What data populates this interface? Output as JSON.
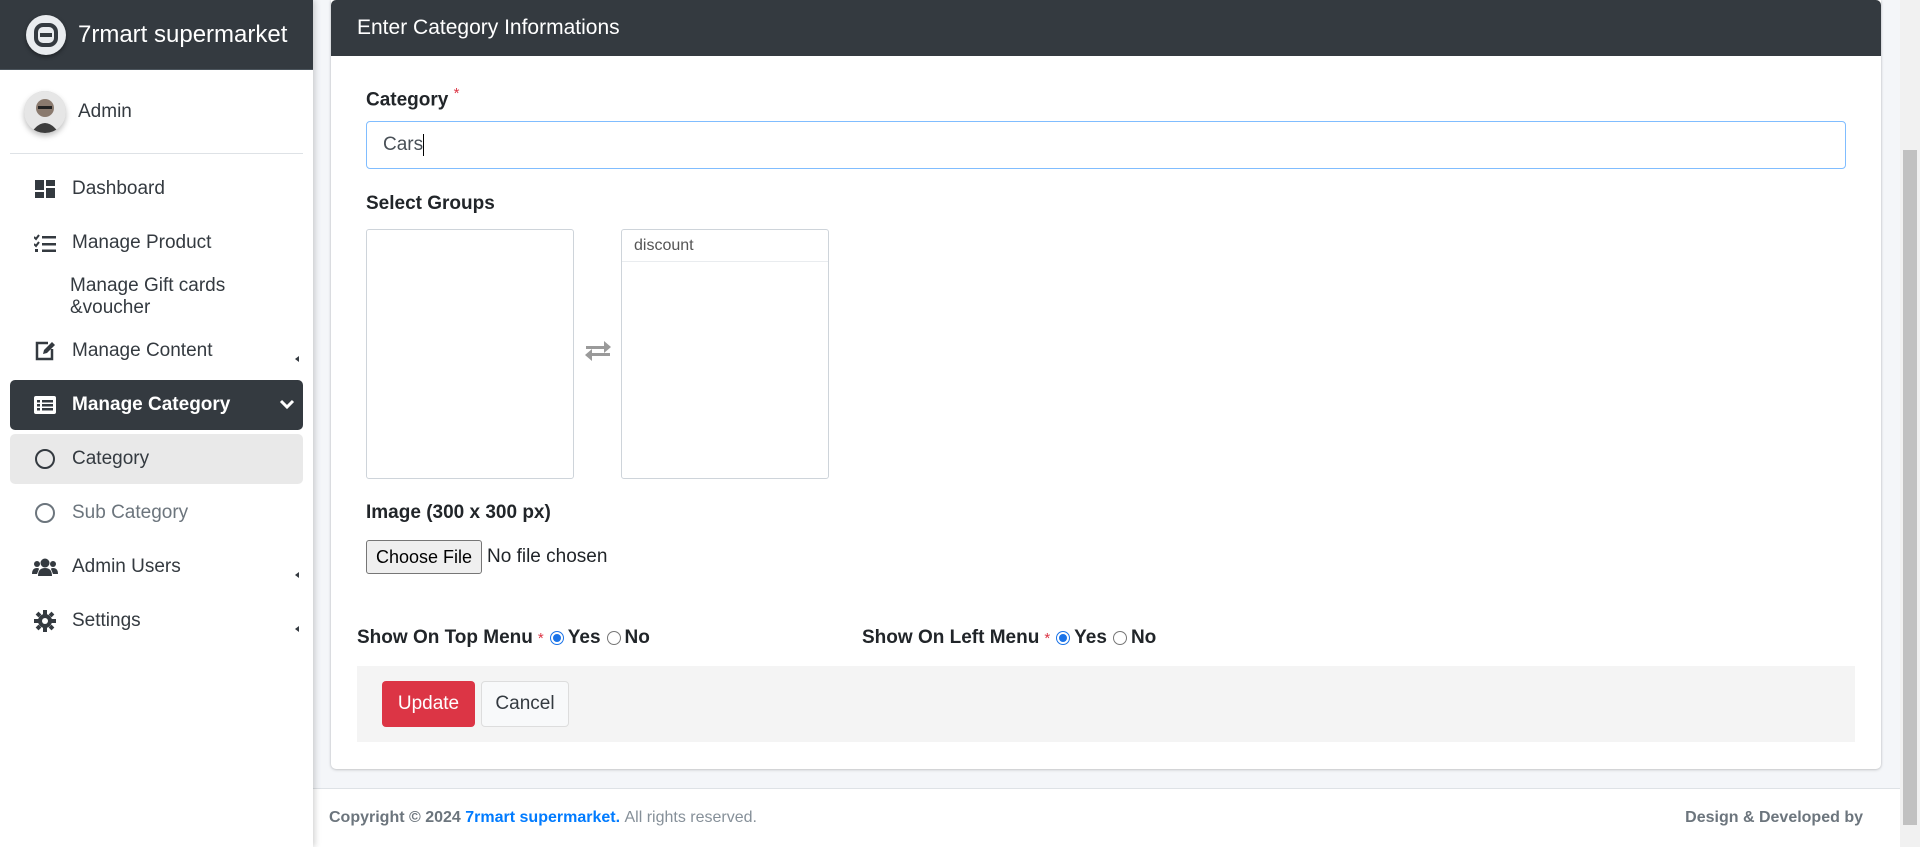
{
  "sidebar": {
    "brand": "7rmart supermarket",
    "user": "Admin",
    "items": [
      {
        "label": "Dashboard",
        "icon": "dashboard-icon"
      },
      {
        "label": "Manage Product",
        "icon": "list-check-icon"
      },
      {
        "label": "Manage Gift cards &voucher",
        "icon": ""
      },
      {
        "label": "Manage Content",
        "icon": "edit-icon"
      },
      {
        "label": "Manage Category",
        "icon": "list-alt-icon"
      },
      {
        "label": "Category",
        "icon": "circle-icon"
      },
      {
        "label": "Sub Category",
        "icon": "circle-icon"
      },
      {
        "label": "Admin Users",
        "icon": "users-icon"
      },
      {
        "label": "Settings",
        "icon": "gear-icon"
      }
    ]
  },
  "form": {
    "header": "Enter Category Informations",
    "category_label": "Category",
    "required_mark": "*",
    "category_value": "Cars",
    "groups_label": "Select Groups",
    "selected_groups": [
      "discount"
    ],
    "image_label": "Image (300 x 300 px)",
    "file_button": "Choose File",
    "file_status": "No file chosen",
    "top_menu_label": "Show On Top Menu",
    "left_menu_label": "Show On Left Menu",
    "yes": "Yes",
    "no": "No",
    "top_menu_selected": "Yes",
    "left_menu_selected": "Yes",
    "update_button": "Update",
    "cancel_button": "Cancel"
  },
  "footer": {
    "copyright": "Copyright © 2024",
    "brand": "7rmart supermarket.",
    "rights": "All rights reserved.",
    "credit": "Design & Developed by"
  },
  "colors": {
    "dark": "#343a40",
    "danger": "#dc3545",
    "link": "#007bff"
  }
}
